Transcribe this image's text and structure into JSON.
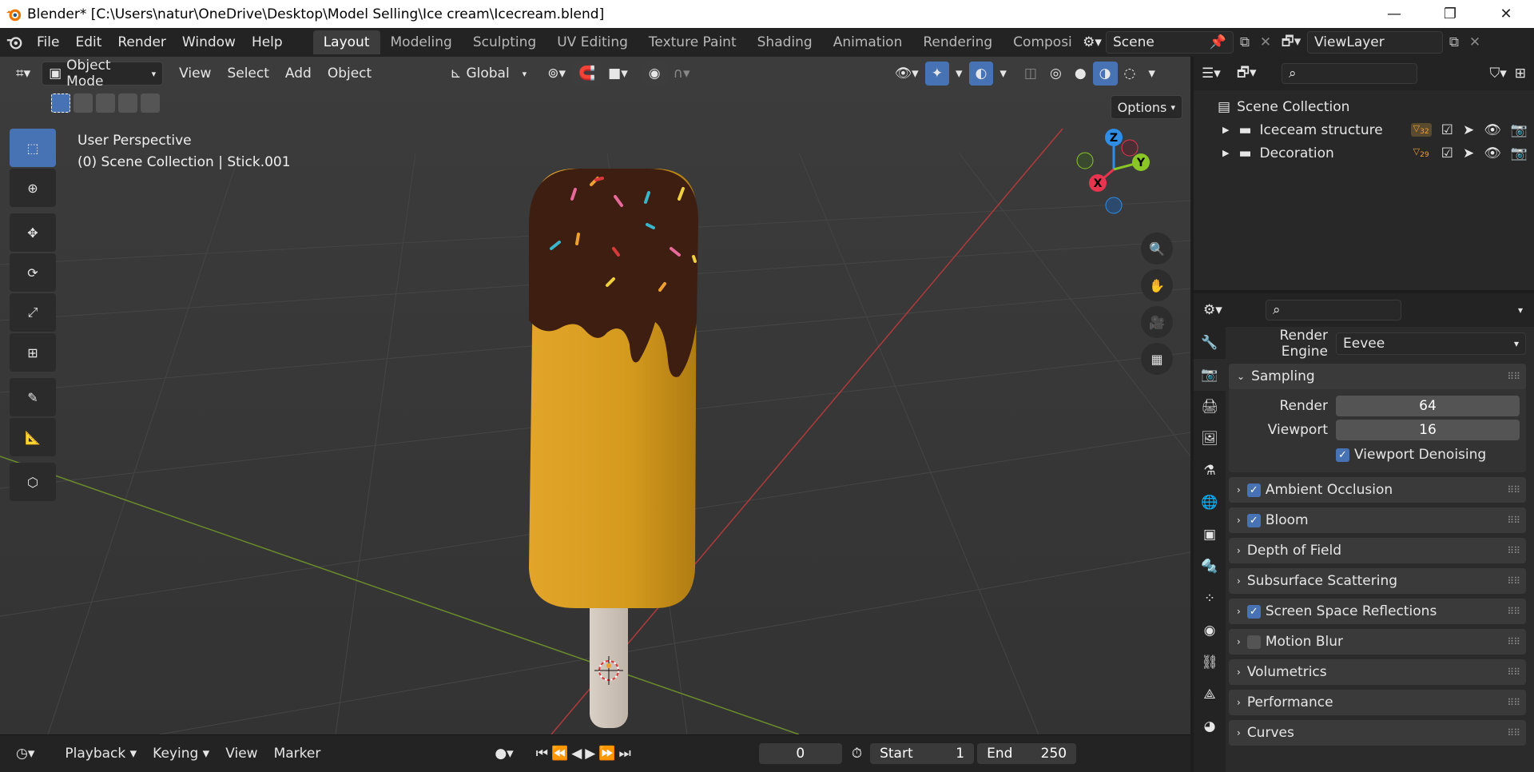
{
  "window": {
    "title": "Blender* [C:\\Users\\natur\\OneDrive\\Desktop\\Model Selling\\Ice cream\\Icecream.blend]",
    "minimize": "—",
    "restore": "❐",
    "close": "✕"
  },
  "menu": [
    "File",
    "Edit",
    "Render",
    "Window",
    "Help"
  ],
  "workspaces": [
    {
      "label": "Layout",
      "active": true
    },
    {
      "label": "Modeling"
    },
    {
      "label": "Sculpting"
    },
    {
      "label": "UV Editing"
    },
    {
      "label": "Texture Paint"
    },
    {
      "label": "Shading"
    },
    {
      "label": "Animation"
    },
    {
      "label": "Rendering"
    },
    {
      "label": "Compositing"
    }
  ],
  "scene": {
    "label": "Scene"
  },
  "viewlayer": {
    "label": "ViewLayer"
  },
  "viewport": {
    "mode": "Object Mode",
    "menus": [
      "View",
      "Select",
      "Add",
      "Object"
    ],
    "orientation": "Global",
    "options_label": "Options",
    "info_line1": "User Perspective",
    "info_line2": "(0) Scene Collection | Stick.001",
    "gizmo": {
      "z": "Z",
      "x": "X",
      "y": "Y"
    }
  },
  "timeline": {
    "menus": [
      "Playback",
      "Keying",
      "View",
      "Marker"
    ],
    "current_frame": "0",
    "start_label": "Start",
    "start_value": "1",
    "end_label": "End",
    "end_value": "250"
  },
  "outliner": {
    "root": "Scene Collection",
    "items": [
      {
        "label": "Iceceam structure",
        "count": "32"
      },
      {
        "label": "Decoration",
        "count": "29"
      }
    ]
  },
  "properties": {
    "render_engine_label": "Render Engine",
    "render_engine_value": "Eevee",
    "sampling_label": "Sampling",
    "render_label": "Render",
    "render_value": "64",
    "viewport_label": "Viewport",
    "viewport_value": "16",
    "denoise_label": "Viewport Denoising",
    "panels": [
      {
        "label": "Ambient Occlusion",
        "checkbox": true,
        "checked": true
      },
      {
        "label": "Bloom",
        "checkbox": true,
        "checked": true
      },
      {
        "label": "Depth of Field",
        "checkbox": false
      },
      {
        "label": "Subsurface Scattering",
        "checkbox": false
      },
      {
        "label": "Screen Space Reflections",
        "checkbox": true,
        "checked": true
      },
      {
        "label": "Motion Blur",
        "checkbox": true,
        "checked": false
      },
      {
        "label": "Volumetrics",
        "checkbox": false
      },
      {
        "label": "Performance",
        "checkbox": false
      },
      {
        "label": "Curves",
        "checkbox": false
      }
    ]
  },
  "colors": {
    "accent": "#4772b3",
    "x_axis": "#e8354f",
    "y_axis": "#8bc627",
    "z_axis": "#2f8de6"
  }
}
